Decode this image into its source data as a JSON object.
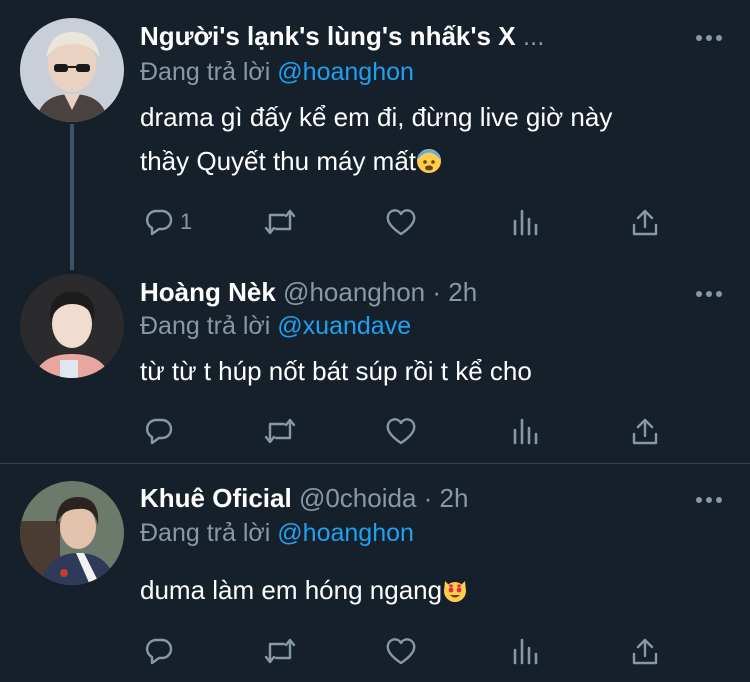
{
  "tweets": [
    {
      "name": "Người's lạnk's lùng's nhấk's X",
      "ellipsis": "...",
      "handle": "",
      "time": "",
      "reply_prefix": "Đang trả lời",
      "reply_to": "@hoanghon",
      "text_lines": [
        "drama gì đấy kể em đi, đừng live giờ này",
        "thầy Quyết thu máy mất"
      ],
      "emoji": "anxious-face-icon",
      "reply_count": "1"
    },
    {
      "name": "Hoàng Nèk",
      "handle": "@hoanghon",
      "time": "· 2h",
      "reply_prefix": "Đang trả lời",
      "reply_to": "@xuandave",
      "text_lines": [
        "từ từ t húp nốt bát súp rồi t kể cho"
      ],
      "reply_count": ""
    },
    {
      "name": "Khuê Oficial",
      "handle": "@0choida",
      "time": "· 2h",
      "reply_prefix": "Đang trả lời",
      "reply_to": "@hoanghon",
      "text_lines": [
        "duma làm em hóng ngang"
      ],
      "emoji": "heart-eyes-cat-icon",
      "reply_count": ""
    }
  ],
  "colors": {
    "background": "#15202b",
    "muted": "#8899a6",
    "accent": "#1da1f2",
    "divider": "#38444d"
  }
}
